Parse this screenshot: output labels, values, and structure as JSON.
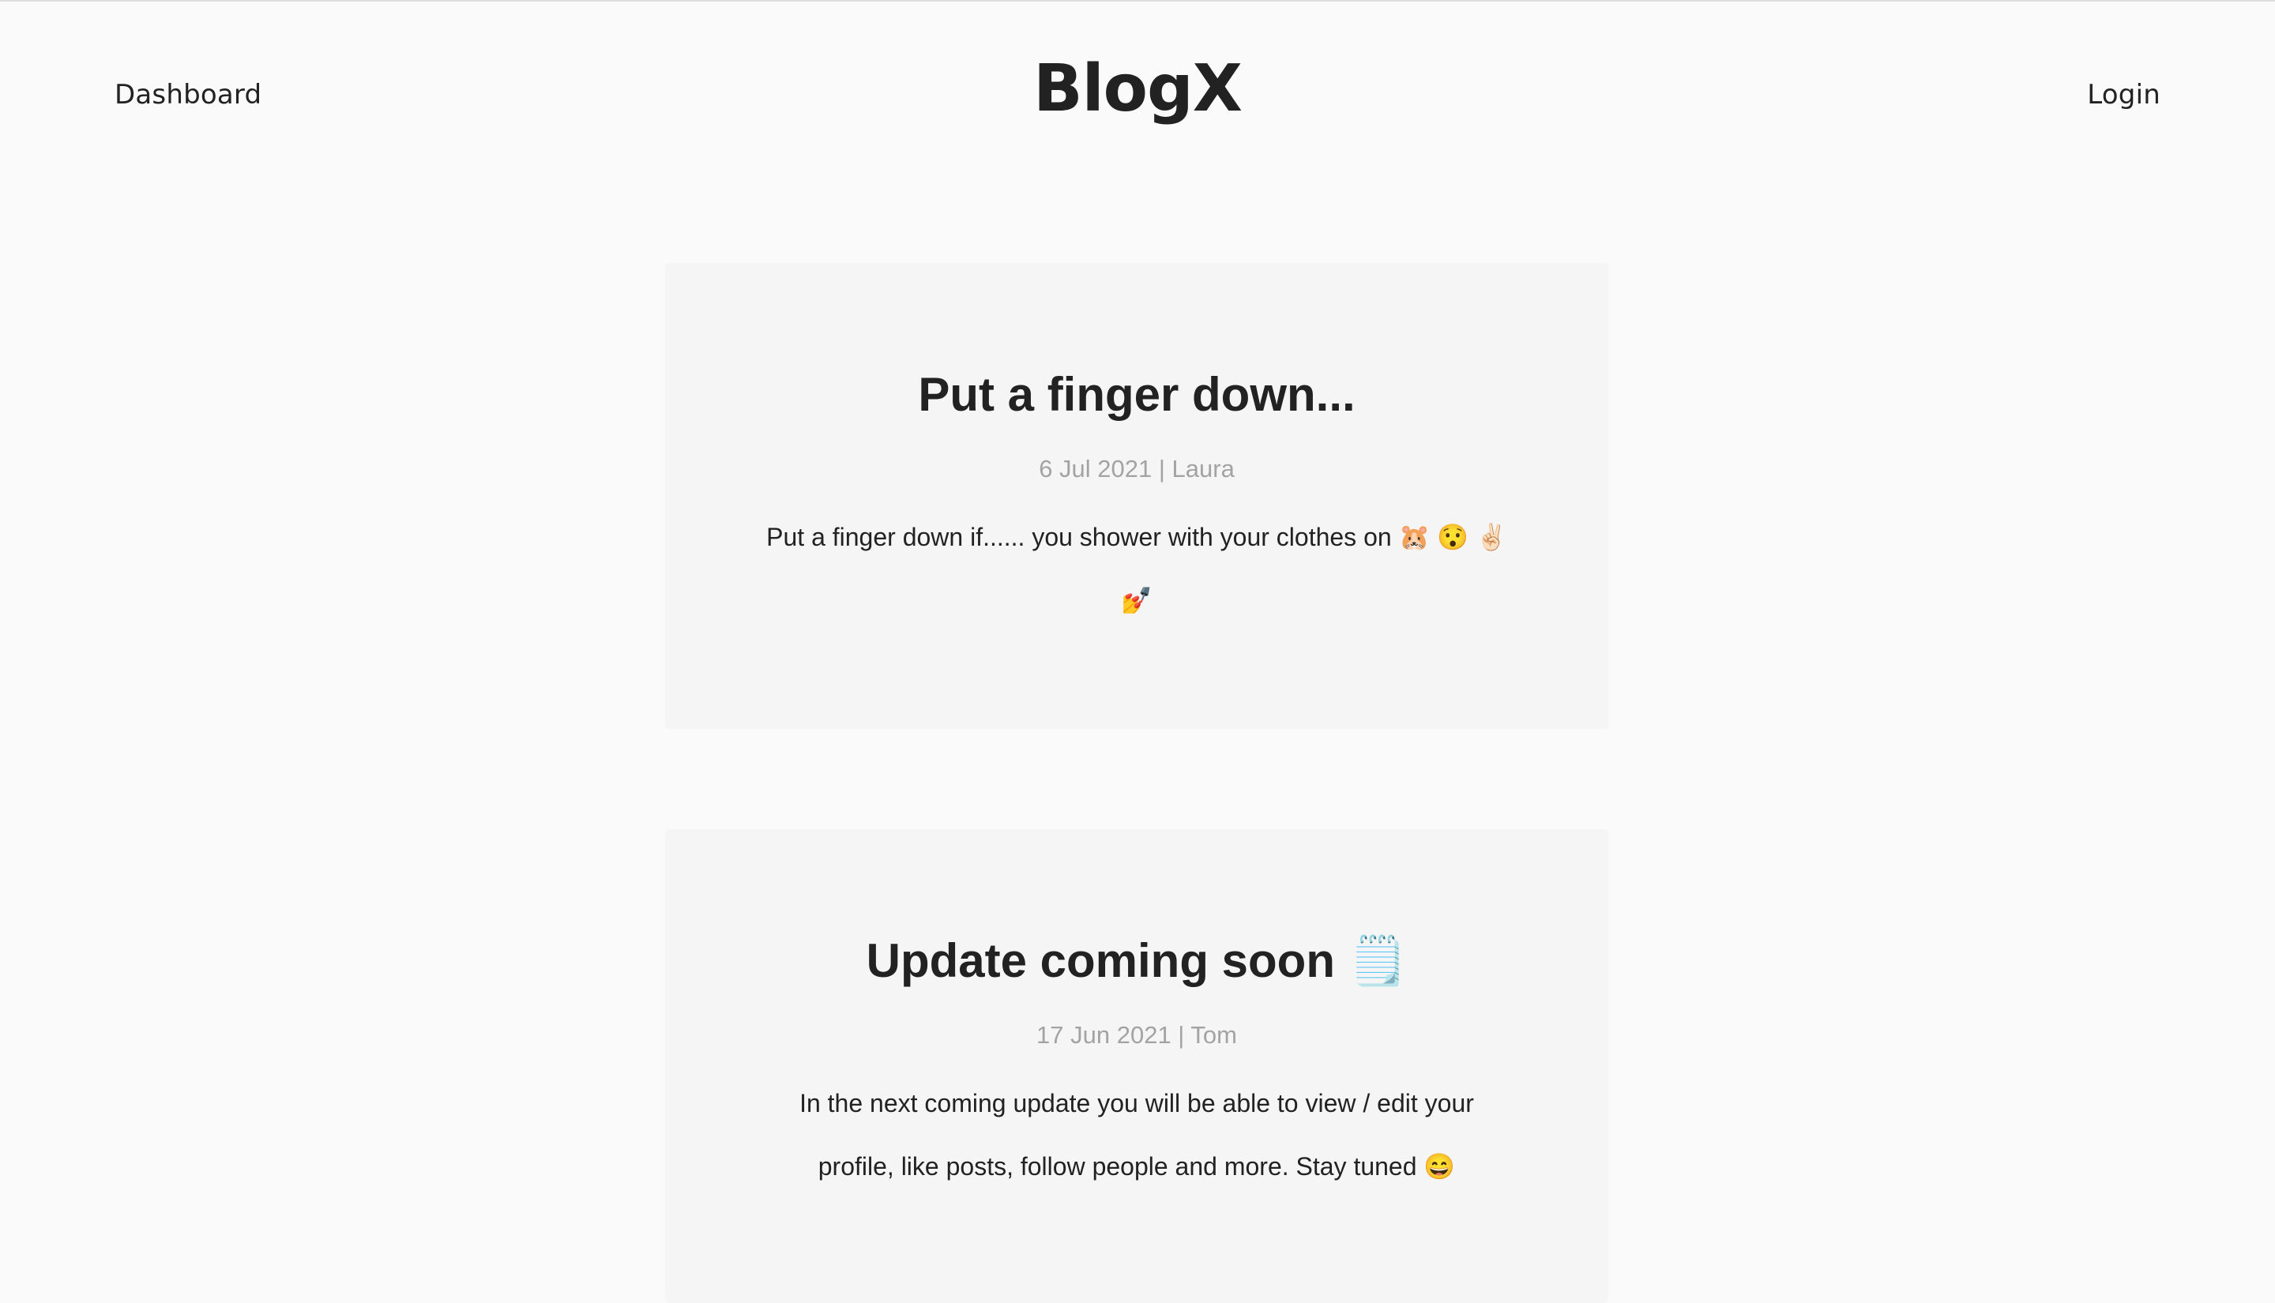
{
  "nav": {
    "left_link": "Dashboard",
    "brand": "BlogX",
    "right_link": "Login"
  },
  "posts": [
    {
      "title": "Put a finger down...",
      "meta": "6 Jul 2021 | Laura",
      "body": "Put a finger down if...... you shower with your clothes on 🐹 😯 ✌🏻 💅"
    },
    {
      "title": "Update coming soon 🗒️",
      "meta": "17 Jun 2021 | Tom",
      "body": "In the next coming update you will be able to view / edit your profile, like posts, follow people and more. Stay tuned 😄"
    }
  ],
  "colors": {
    "background": "#fafafa",
    "card": "#f5f5f5",
    "text": "#222222",
    "meta": "#a3a3a3"
  }
}
